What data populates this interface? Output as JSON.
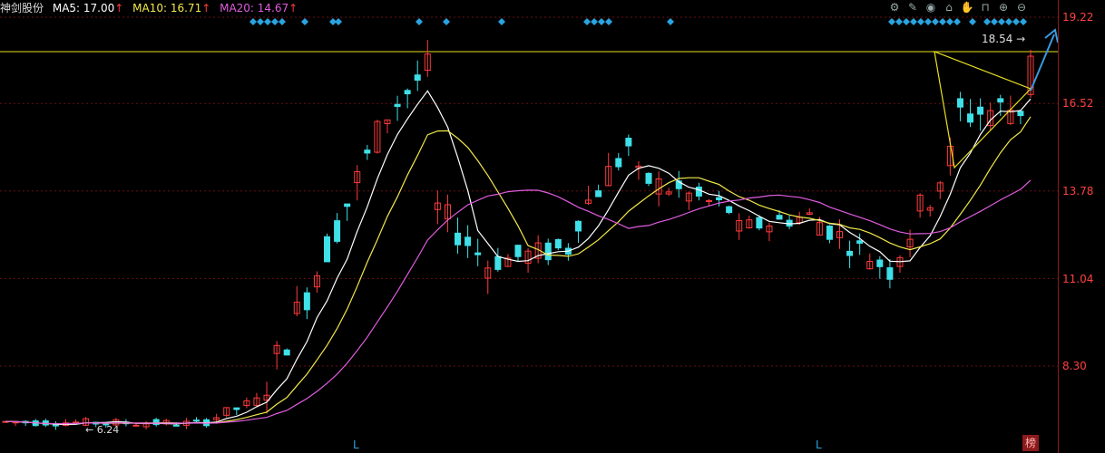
{
  "header": {
    "stock_name": "神剑股份",
    "ma5_label": "MA5: 17.00",
    "ma10_label": "MA10: 16.71",
    "ma20_label": "MA20: 14.67",
    "arrow": "↑"
  },
  "toolbar": {
    "icons": [
      "settings-icon",
      "pen-icon",
      "eye-icon",
      "store-icon",
      "hand-icon",
      "lock-icon",
      "plus-circle-icon",
      "minus-circle-icon"
    ]
  },
  "axis": {
    "labels": [
      "19.22",
      "16.52",
      "13.78",
      "11.04",
      "8.30"
    ]
  },
  "annotations": {
    "high_value": "18.54",
    "low_value": "6.24",
    "markers": [
      "L",
      "L"
    ],
    "bang_label": "榜"
  },
  "colors": {
    "up": "#ff3b3b",
    "down": "#3fe0e8",
    "ma5": "#ffffff",
    "ma10": "#f2e84a",
    "ma20": "#e05ce0",
    "diamond": "#2aa4e0",
    "hline": "#e8e020",
    "arrow": "#3a9ae0"
  }
}
